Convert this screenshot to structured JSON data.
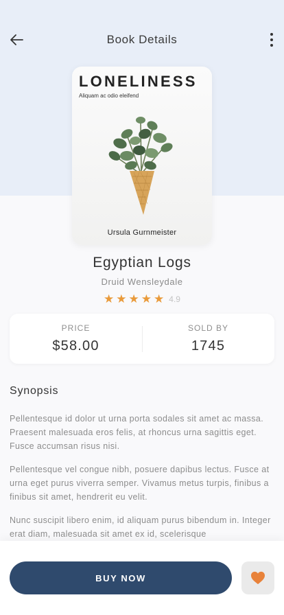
{
  "header": {
    "title": "Book Details",
    "back_icon": "arrow-left-icon",
    "more_icon": "more-vertical-icon"
  },
  "book": {
    "cover": {
      "title": "LONELINESS",
      "subtitle": "Aliquam ac odio eleifend",
      "author": "Ursula Gurnmeister"
    },
    "title": "Egyptian Logs",
    "author": "Druid Wensleydale",
    "rating": {
      "stars": 5,
      "value": "4.9",
      "star_color": "#e99a3a"
    }
  },
  "stats": {
    "price_label": "PRICE",
    "price_value": "$58.00",
    "sold_label": "SOLD BY",
    "sold_value": "1745"
  },
  "synopsis": {
    "heading": "Synopsis",
    "paragraphs": [
      "Pellentesque id dolor ut urna porta sodales sit amet ac massa. Praesent malesuada eros felis, at rhoncus urna sagittis eget. Fusce accumsan risus nisi.",
      "Pellentesque vel congue nibh, posuere dapibus lectus. Fusce at urna eget purus viverra semper. Vivamus metus turpis, finibus a finibus sit amet, hendrerit eu velit.",
      "Nunc suscipit libero enim, id aliquam purus bibendum in. Integer erat diam, malesuada sit amet ex id, scelerisque"
    ]
  },
  "actions": {
    "buy_label": "BUY NOW",
    "favorite_icon": "heart-icon",
    "buy_color": "#2f4a6d",
    "favorite_color": "#e8823a"
  }
}
